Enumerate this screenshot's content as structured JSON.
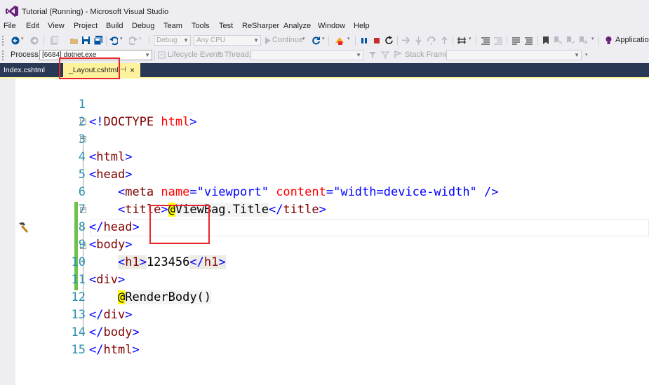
{
  "window": {
    "title": "Tutorial (Running) - Microsoft Visual Studio"
  },
  "menu": [
    "File",
    "Edit",
    "View",
    "Project",
    "Build",
    "Debug",
    "Team",
    "Tools",
    "Test",
    "ReSharper",
    "Analyze",
    "Window",
    "Help"
  ],
  "toolbar": {
    "config": "Debug",
    "platform": "Any CPU",
    "continue_label": "Continue",
    "application_label": "Application"
  },
  "debug_location": {
    "process_label": "Process:",
    "process_value": "[6684] dotnet.exe",
    "lifecycle_label": "Lifecycle Events",
    "thread_label": "Thread:",
    "stack_frame_label": "Stack Frame:"
  },
  "tabs": [
    {
      "label": "Index.cshtml",
      "active": false
    },
    {
      "label": "_Layout.cshtml",
      "active": true,
      "pin_glyph": "⊣",
      "close_glyph": "×"
    }
  ],
  "editor": {
    "line_numbers": [
      "1",
      "2",
      "3",
      "4",
      "5",
      "6",
      "7",
      "8",
      "9",
      "10",
      "11",
      "12",
      "13",
      "14",
      "15"
    ],
    "code": {
      "l1_open": "<!",
      "l1_tag": "DOCTYPE",
      "l1_attr": " html",
      "l1_close": ">",
      "l3_open": "<",
      "l3_tag": "html",
      "l3_close": ">",
      "l4_open": "<",
      "l4_tag": "head",
      "l4_close": ">",
      "l5_indent": "    ",
      "l5_open": "<",
      "l5_tag": "meta",
      "l5_attr1": " name",
      "l5_eq1": "=",
      "l5_val1": "\"viewport\"",
      "l5_attr2": " content",
      "l5_eq2": "=",
      "l5_val2": "\"width=device-width\"",
      "l5_close": " />",
      "l6_indent": "    ",
      "l6_open": "<",
      "l6_tag": "title",
      "l6_close": ">",
      "l6_at": "@",
      "l6_expr": "ViewBag.Title",
      "l6_end_open": "</",
      "l6_end_tag": "title",
      "l6_end_close": ">",
      "l7_open": "</",
      "l7_tag": "head",
      "l7_close": ">",
      "l8_open": "<",
      "l8_tag": "body",
      "l8_close": ">",
      "l9_indent": "    ",
      "l9_open": "<",
      "l9_tag": "h1",
      "l9_close": ">",
      "l9_text": "123456",
      "l9_end_open": "</",
      "l9_end_tag": "h1",
      "l9_end_close": ">",
      "l10_open": "<",
      "l10_tag": "div",
      "l10_close": ">",
      "l11_indent": "    ",
      "l11_at": "@",
      "l11_expr": "RenderBody()",
      "l12_open": "</",
      "l12_tag": "div",
      "l12_close": ">",
      "l13_open": "</",
      "l13_tag": "body",
      "l13_close": ">",
      "l14_open": "</",
      "l14_tag": "html",
      "l14_close": ">"
    },
    "colors": {
      "line_number": "#2b91af",
      "tag_name": "#800000",
      "attribute": "#ff0000",
      "bracket": "#0000ff",
      "razor_highlight": "#ffff00",
      "changed_bar": "#6cc24a"
    }
  },
  "annotation_color": "#e8262a"
}
